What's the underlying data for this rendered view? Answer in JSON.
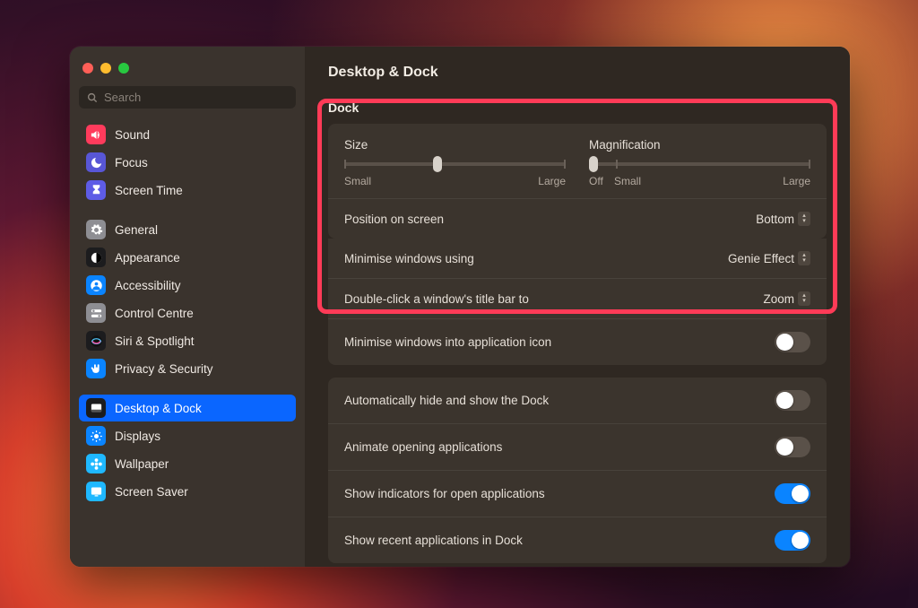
{
  "window": {
    "title": "Desktop & Dock",
    "section_title": "Dock",
    "search_placeholder": "Search"
  },
  "sidebar": {
    "groups": [
      {
        "items": [
          {
            "id": "sound",
            "icon_bg": "#ff3b5c",
            "glyph": "speaker",
            "label": "Sound"
          },
          {
            "id": "focus",
            "icon_bg": "#5856d6",
            "glyph": "moon",
            "label": "Focus"
          },
          {
            "id": "screen-time",
            "icon_bg": "#5e5ce6",
            "glyph": "hourglass",
            "label": "Screen Time"
          }
        ]
      },
      {
        "items": [
          {
            "id": "general",
            "icon_bg": "#8e8e93",
            "glyph": "gear",
            "label": "General"
          },
          {
            "id": "appearance",
            "icon_bg": "#1c1c1e",
            "glyph": "appearance",
            "label": "Appearance"
          },
          {
            "id": "accessibility",
            "icon_bg": "#0a84ff",
            "glyph": "person",
            "label": "Accessibility"
          },
          {
            "id": "control-centre",
            "icon_bg": "#8e8e93",
            "glyph": "switches",
            "label": "Control Centre"
          },
          {
            "id": "siri",
            "icon_bg": "#1c1c1e",
            "glyph": "siri",
            "label": "Siri & Spotlight"
          },
          {
            "id": "privacy",
            "icon_bg": "#0a84ff",
            "glyph": "hand",
            "label": "Privacy & Security"
          }
        ]
      },
      {
        "items": [
          {
            "id": "desktop-dock",
            "icon_bg": "#1c1c1e",
            "glyph": "dock",
            "label": "Desktop & Dock",
            "selected": true
          },
          {
            "id": "displays",
            "icon_bg": "#0a84ff",
            "glyph": "sun",
            "label": "Displays"
          },
          {
            "id": "wallpaper",
            "icon_bg": "#1fb8ff",
            "glyph": "flower",
            "label": "Wallpaper"
          },
          {
            "id": "screen-saver",
            "icon_bg": "#1fb8ff",
            "glyph": "screensaver",
            "label": "Screen Saver"
          }
        ]
      }
    ]
  },
  "dock": {
    "size": {
      "label": "Size",
      "min_label": "Small",
      "max_label": "Large",
      "value_pct": 42
    },
    "magnification": {
      "label": "Magnification",
      "off_label": "Off",
      "min_label": "Small",
      "max_label": "Large",
      "value_pct": 2
    },
    "position": {
      "label": "Position on screen",
      "value": "Bottom"
    },
    "minimise_using": {
      "label": "Minimise windows using",
      "value": "Genie Effect"
    },
    "double_click": {
      "label": "Double-click a window's title bar to",
      "value": "Zoom"
    },
    "minimise_into_icon": {
      "label": "Minimise windows into application icon",
      "value": false
    },
    "auto_hide": {
      "label": "Automatically hide and show the Dock",
      "value": false
    },
    "animate_opening": {
      "label": "Animate opening applications",
      "value": false
    },
    "show_indicators": {
      "label": "Show indicators for open applications",
      "value": true
    },
    "show_recent": {
      "label": "Show recent applications in Dock",
      "value": true
    }
  }
}
